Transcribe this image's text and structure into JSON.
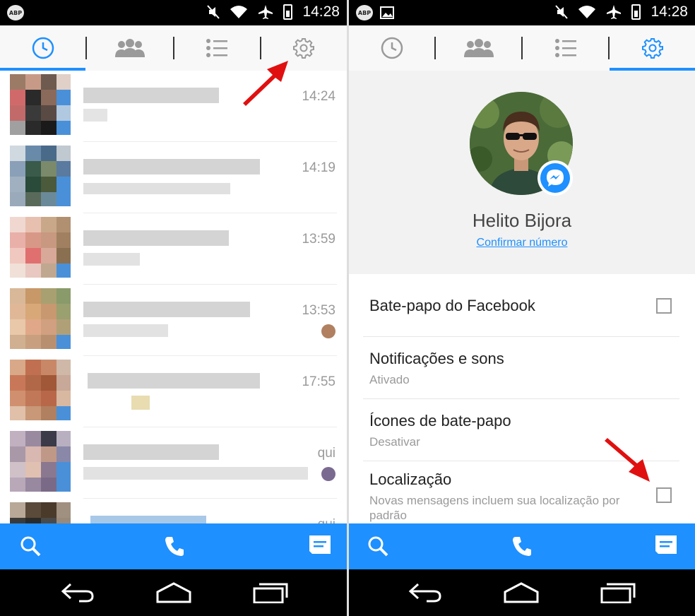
{
  "status_bar": {
    "abp_label": "ABP",
    "time": "14:28"
  },
  "tabs": [
    {
      "name": "recent",
      "icon": "clock-icon"
    },
    {
      "name": "groups",
      "icon": "people-icon"
    },
    {
      "name": "people",
      "icon": "list-icon"
    },
    {
      "name": "settings",
      "icon": "gear-icon"
    }
  ],
  "left_screen": {
    "active_tab": "recent",
    "conversations": [
      {
        "time": "14:24"
      },
      {
        "time": "14:19"
      },
      {
        "time": "13:59"
      },
      {
        "time": "13:53"
      },
      {
        "time": "17:55"
      },
      {
        "time": "qui"
      },
      {
        "time": "qui"
      }
    ]
  },
  "right_screen": {
    "active_tab": "settings",
    "profile": {
      "name": "Helito Bijora",
      "link": "Confirmar número"
    },
    "settings": [
      {
        "title": "Bate-papo do Facebook",
        "subtitle": "",
        "checkbox": true,
        "checked": false
      },
      {
        "title": "Notificações e sons",
        "subtitle": "Ativado",
        "checkbox": false
      },
      {
        "title": "Ícones de bate-papo",
        "subtitle": "Desativar",
        "checkbox": false
      },
      {
        "title": "Localização",
        "subtitle": "Novas mensagens incluem sua localização por padrão",
        "checkbox": true,
        "checked": false
      }
    ]
  },
  "bottom_bar": {
    "icons": [
      "search-icon",
      "phone-icon",
      "compose-icon"
    ]
  },
  "nav_bar": {
    "icons": [
      "back-icon",
      "home-icon",
      "recents-icon"
    ]
  },
  "colors": {
    "accent": "#1e90ff",
    "arrow": "#e01010"
  }
}
